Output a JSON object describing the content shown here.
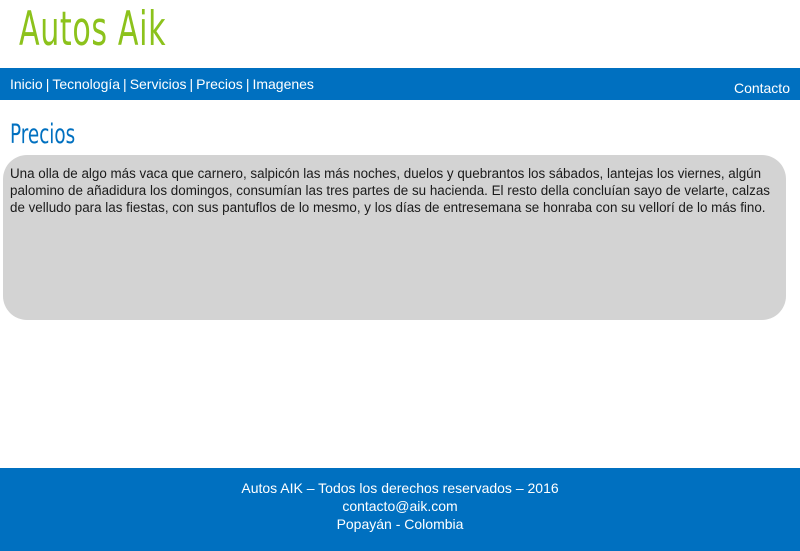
{
  "site": {
    "logo_text": "Autos Aik"
  },
  "nav": {
    "links": [
      {
        "label": "Inicio"
      },
      {
        "label": "Tecnología"
      },
      {
        "label": "Servicios"
      },
      {
        "label": "Precios"
      },
      {
        "label": "Imagenes"
      }
    ],
    "separator": "|",
    "contact_label": "Contacto"
  },
  "main": {
    "title": "Precios",
    "body": "Una olla de algo más vaca que carnero, salpicón las más noches, duelos y quebrantos los sábados, lantejas los viernes, algún palomino de añadidura los domingos, consumían las tres partes de su hacienda. El resto della concluían sayo de velarte, calzas de velludo para las fiestas, con sus pantuflos de lo mesmo, y los días de entresemana se honraba con su vellorí de lo más fino."
  },
  "footer": {
    "copyright": "Autos AIK – Todos los derechos reservados – 2016",
    "email": "contacto@aik.com",
    "location": "Popayán - Colombia"
  },
  "colors": {
    "brand_green": "#8cc21c",
    "brand_blue": "#0070c0",
    "content_bg": "#d3d3d3",
    "text": "#1a1a1a",
    "white": "#ffffff"
  }
}
